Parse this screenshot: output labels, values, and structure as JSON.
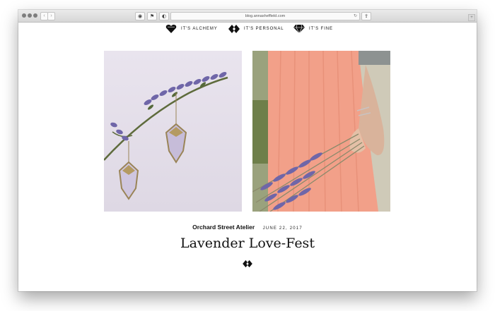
{
  "browser": {
    "address": "blog.annasheffield.com",
    "back_glyph": "‹",
    "forward_glyph": "›",
    "reload_glyph": "↻",
    "toolbar_icons": [
      "tab-icon",
      "pin-icon",
      "privacy-icon",
      "share-icon"
    ],
    "toolbar_glyphs": [
      "◉",
      "⚑",
      "◐",
      "⇪"
    ],
    "corner_glyph": "+"
  },
  "nav": {
    "items": [
      {
        "label": "IT'S ALCHEMY",
        "icon": "heart-gem-icon"
      },
      {
        "label": "IT'S PERSONAL",
        "icon": "double-diamond-icon"
      },
      {
        "label": "IT'S FINE",
        "icon": "faceted-gem-icon"
      }
    ]
  },
  "post": {
    "author": "Orchard Street Atelier",
    "date": "JUNE 22, 2017",
    "title": "Lavender Love-Fest",
    "divider_icon": "double-diamond-icon"
  },
  "images": [
    {
      "subject": "lavender-earrings-photo"
    },
    {
      "subject": "lavender-bouquet-photo"
    }
  ],
  "colors": {
    "toolbar": "#e0e0e0",
    "text": "#111111",
    "skirt": "#f2a089",
    "lavender": "#6f66a8"
  }
}
